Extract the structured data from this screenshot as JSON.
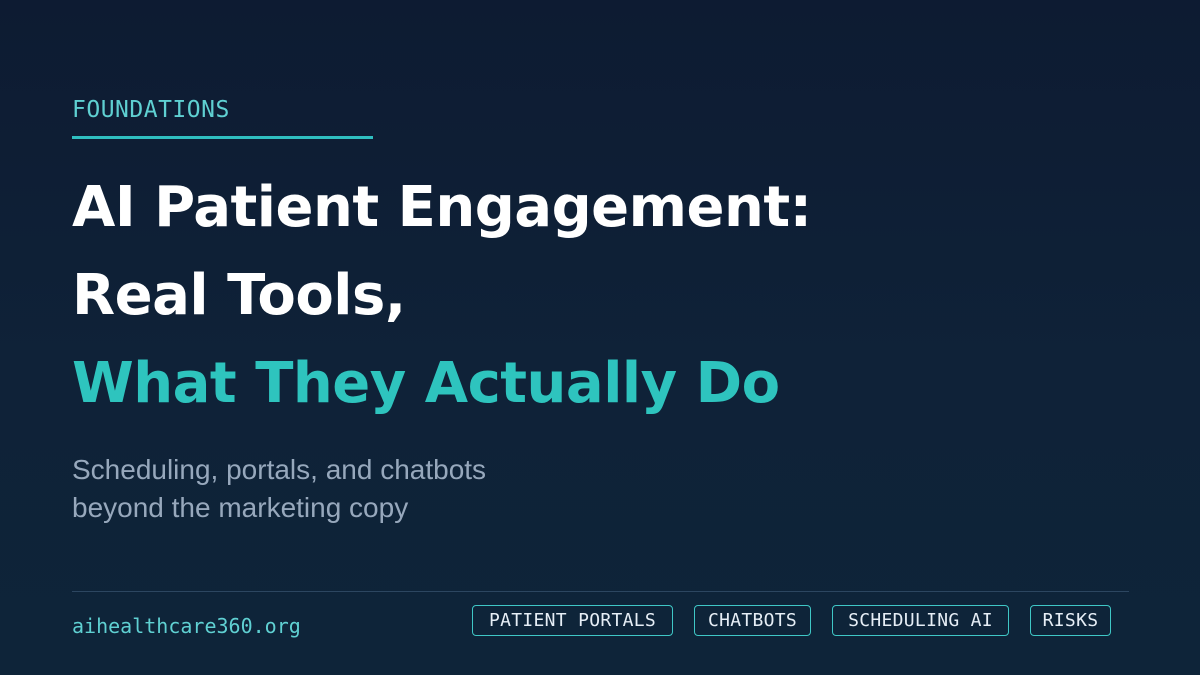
{
  "eyebrow": "FOUNDATIONS",
  "headline": {
    "line1": "AI Patient Engagement:",
    "line2": "Real Tools,",
    "line3": "What They Actually Do"
  },
  "subtitle": {
    "line1": "Scheduling, portals, and chatbots",
    "line2": "beyond the marketing copy"
  },
  "footer": {
    "site": "aihealthcare360.org",
    "tags": [
      "PATIENT PORTALS",
      "CHATBOTS",
      "SCHEDULING AI",
      "RISKS"
    ]
  },
  "colors": {
    "background": "#0d1b32",
    "accent": "#2ec4be",
    "eyebrow": "#5fd0d2",
    "headline": "#ffffff",
    "subtitle": "#97a8bc",
    "tag_border": "#3fc7c6"
  }
}
